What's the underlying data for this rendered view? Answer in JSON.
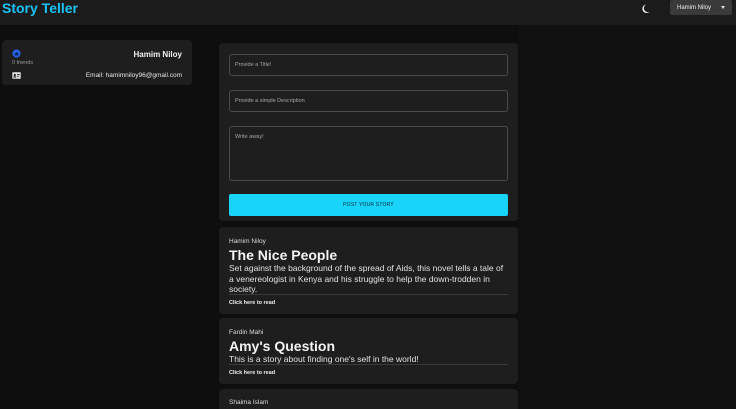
{
  "app": {
    "brand": "Story Teller"
  },
  "header": {
    "user_menu_label": "Hamim Niloy"
  },
  "profile": {
    "name": "Hamim Niloy",
    "friends": "0 friends",
    "email": "Email: hamimniloy96@gmail.com"
  },
  "composer": {
    "title_placeholder": "Provide a Title!",
    "description_placeholder": "Provide a simple Description",
    "body_placeholder": "Write away!",
    "post_label": "POST YOUR STORY"
  },
  "stories": [
    {
      "author": "Hamim Niloy",
      "title": "The Nice People",
      "description": "Set against the background of the spread of Aids, this novel tells a tale of a venereologist in Kenya and his struggle to help the down-trodden in society.",
      "link": "Click here to read"
    },
    {
      "author": "Fardin Mahi",
      "title": "Amy's Question",
      "description": "This is a story about finding one's self in the world!",
      "link": "Click here to read"
    },
    {
      "author": "Shaima Islam"
    }
  ],
  "colors": {
    "accent": "#18d4fb",
    "brand": "#19c3f5",
    "card": "#1e1e1e",
    "background": "#0e0e0e"
  },
  "icons": {
    "theme": "moon-icon",
    "profile": "home-icon",
    "contact": "id-card-icon",
    "menu": "caret-down-icon"
  }
}
